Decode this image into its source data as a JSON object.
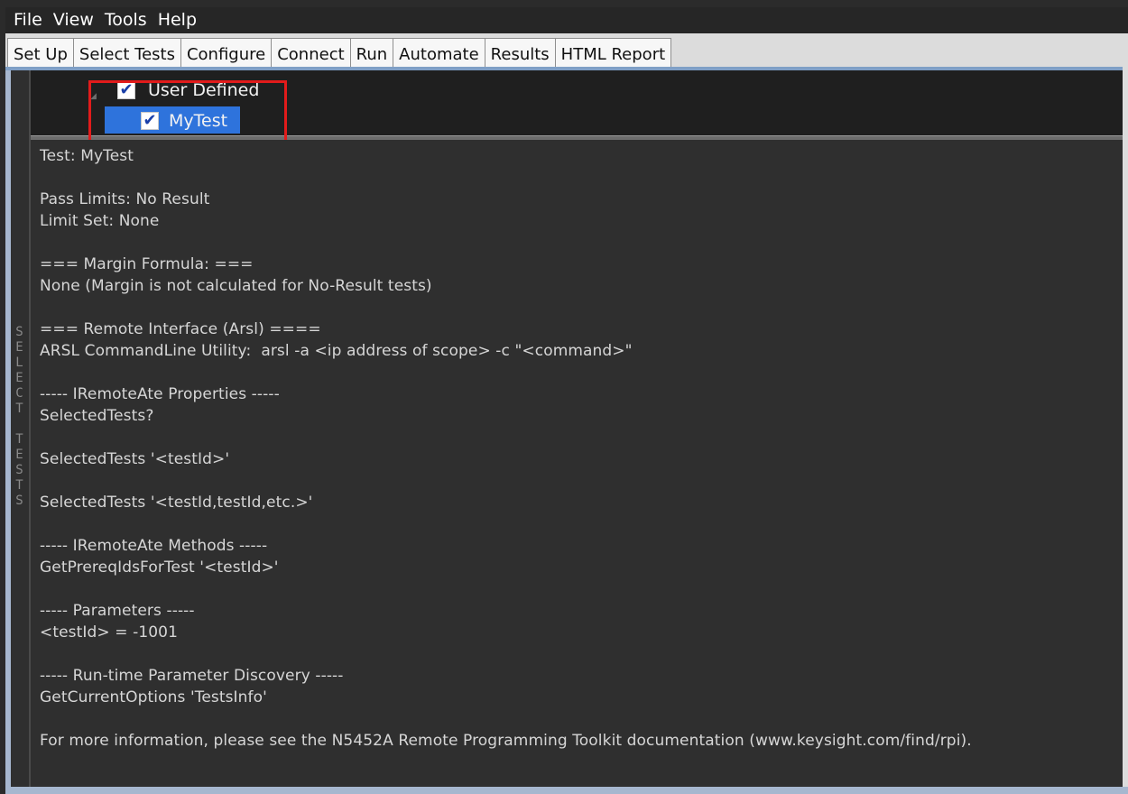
{
  "menu": [
    "File",
    "View",
    "Tools",
    "Help"
  ],
  "tabs": [
    "Set Up",
    "Select Tests",
    "Configure",
    "Connect",
    "Run",
    "Automate",
    "Results",
    "HTML Report"
  ],
  "side_label": "SELECT TESTS",
  "tree": {
    "root": {
      "label": "User Defined",
      "checked": true
    },
    "child": {
      "label": "MyTest",
      "checked": true,
      "selected": true
    }
  },
  "info_lines": [
    "Test: MyTest",
    "Pass Limits: No Result",
    "Limit Set: None",
    "=== Margin Formula: ===",
    "None (Margin is not calculated for No-Result tests)",
    "=== Remote Interface (Arsl) ====",
    "ARSL CommandLine Utility:  arsl -a <ip address of scope> -c \"<command>\"",
    "----- IRemoteAte Properties -----",
    "SelectedTests?",
    "SelectedTests '<testId>'",
    "SelectedTests '<testId,testId,etc.>'",
    "----- IRemoteAte Methods -----",
    "GetPrereqIdsForTest '<testId>'",
    "----- Parameters -----",
    "<testId> = -1001",
    "----- Run-time Parameter Discovery -----",
    "GetCurrentOptions 'TestsInfo'",
    "For more information, please see the N5452A Remote Programming Toolkit documentation (www.keysight.com/find/rpi)."
  ],
  "colors": {
    "accent": "#2e73dc",
    "highlight": "#e21b1b",
    "background": "#2f2f2f",
    "text": "#d6d6d6"
  },
  "icons": {
    "checkbox": "checkmark",
    "expander": "triangle-collapse"
  }
}
